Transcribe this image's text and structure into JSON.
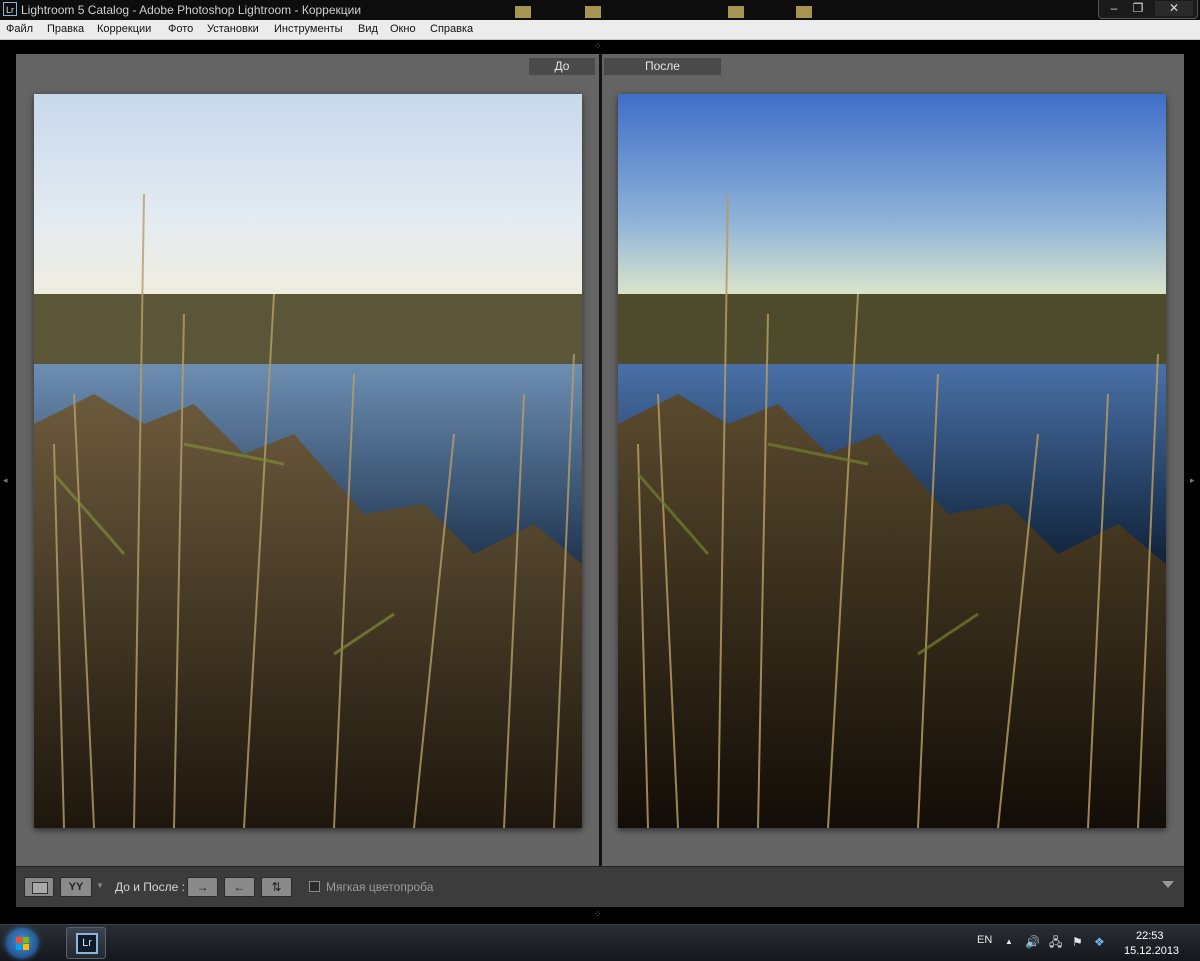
{
  "window": {
    "title": "Lightroom 5 Catalog - Adobe Photoshop Lightroom - Коррекции",
    "app_badge": "Lr",
    "controls": {
      "minimize": "–",
      "restore": "❐",
      "close": "✕"
    }
  },
  "menu": {
    "items": [
      "Файл",
      "Правка",
      "Коррекции",
      "Фото",
      "Установки",
      "Инструменты",
      "Вид",
      "Окно",
      "Справка"
    ]
  },
  "viewer": {
    "before_label": "До",
    "after_label": "После"
  },
  "toolbar": {
    "before_after_label": "До и После :",
    "view_mode_icon": "YY",
    "soft_proofing_label": "Мягкая цветопроба",
    "soft_proofing_checked": false
  },
  "taskbar": {
    "active_app": "Lr",
    "language": "EN",
    "time": "22:53",
    "date": "15.12.2013"
  },
  "colors": {
    "panel_bg": "#646464",
    "toolbar_bg": "#3c3c3c",
    "tab_bg": "#4a4a4a"
  }
}
